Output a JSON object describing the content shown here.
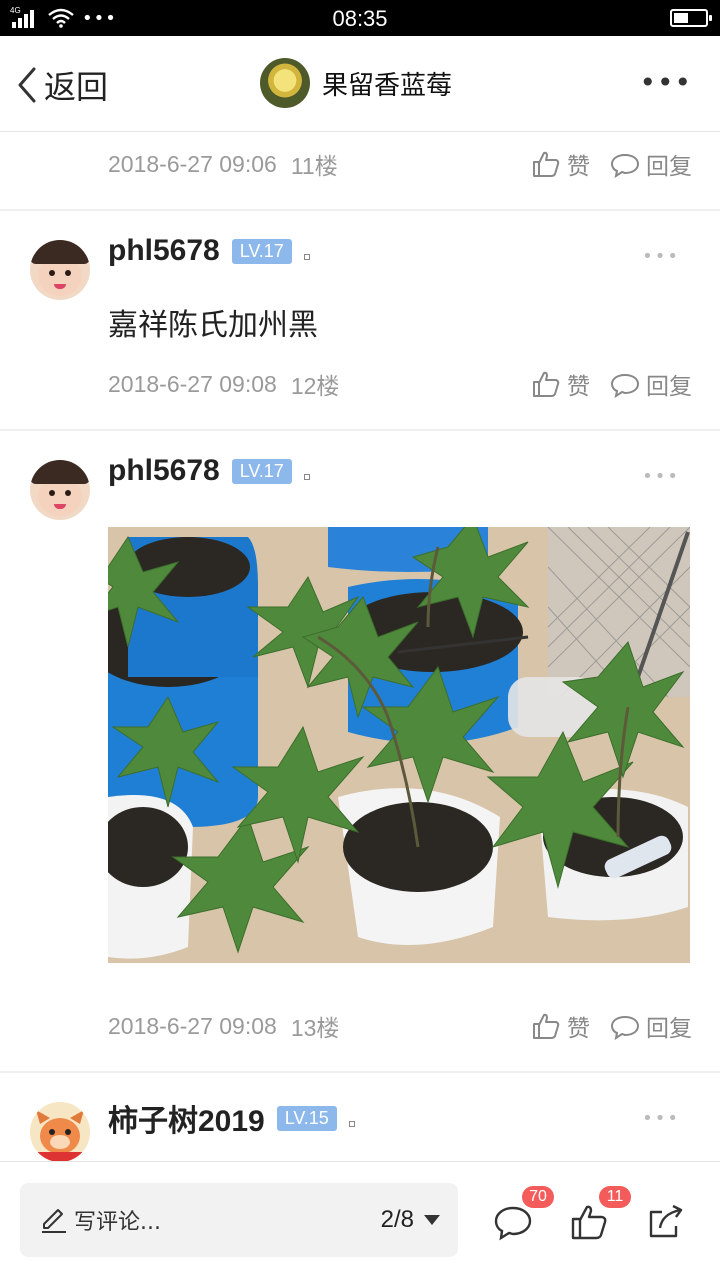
{
  "status_bar": {
    "network": "4G",
    "time": "08:35",
    "battery_level": 0.45
  },
  "nav": {
    "back_label": "返回",
    "title": "果留香蓝莓",
    "more_label": "•••"
  },
  "floor_11": {
    "timestamp": "2018-6-27 09:06",
    "floor": "11楼",
    "like_label": "赞",
    "reply_label": "回复"
  },
  "post_12": {
    "username": "phl5678",
    "level": "LV.17",
    "content": "嘉祥陈氏加州黑",
    "timestamp": "2018-6-27 09:08",
    "floor": "12楼",
    "like_label": "赞",
    "reply_label": "回复"
  },
  "post_13": {
    "username": "phl5678",
    "level": "LV.17",
    "image_icon": "potted-fig-trees-photo",
    "timestamp": "2018-6-27 09:08",
    "floor": "13楼",
    "like_label": "赞",
    "reply_label": "回复"
  },
  "post_14": {
    "username": "柿子树2019",
    "level": "LV.15"
  },
  "post_more_label": "•••",
  "bottom_bar": {
    "comment_placeholder": "写评论...",
    "page_indicator": "2/8",
    "comment_count": "70",
    "like_count": "11"
  },
  "colors": {
    "level_badge": "#8db8ec",
    "badge_red": "#f45c5c",
    "meta_gray": "#9a9a9a"
  }
}
